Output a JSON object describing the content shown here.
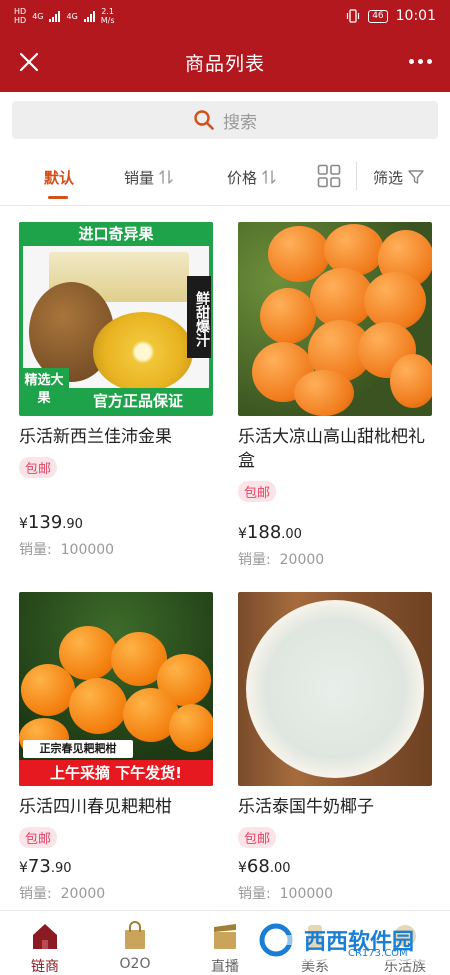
{
  "status_bar": {
    "sim1": "HD",
    "sim2": "HD",
    "net1": "4G",
    "net2": "4G",
    "speed": "2.1",
    "speed_unit": "M/s",
    "battery": "46",
    "time": "10:01"
  },
  "header": {
    "title": "商品列表",
    "close_icon": "close-icon",
    "more_icon": "more-icon"
  },
  "search": {
    "placeholder": "搜索"
  },
  "sort_bar": {
    "default_label": "默认",
    "sales_label": "销量",
    "price_label": "价格",
    "filter_label": "筛选"
  },
  "products": [
    {
      "title": "乐活新西兰佳沛金果",
      "tag": "包邮",
      "price_symbol": "¥",
      "price_int": "139",
      "price_dec": ".90",
      "sales_label": "销量:",
      "sales_value": "100000",
      "banner_top": "进口奇异果",
      "banner_side": "鲜甜爆汁",
      "banner_corner": "精选大果",
      "banner_bottom": "官方正品保证"
    },
    {
      "title": "乐活大凉山高山甜枇杷礼盒",
      "tag": "包邮",
      "price_symbol": "¥",
      "price_int": "188",
      "price_dec": ".00",
      "sales_label": "销量:",
      "sales_value": "20000"
    },
    {
      "title": "乐活四川春见耙耙柑",
      "tag": "包邮",
      "price_symbol": "¥",
      "price_int": "73",
      "price_dec": ".90",
      "sales_label": "销量:",
      "sales_value": "20000",
      "banner_label": "正宗春见耙耙柑",
      "banner_bottom": "上午采摘 下午发货!"
    },
    {
      "title": "乐活泰国牛奶椰子",
      "tag": "包邮",
      "price_symbol": "¥",
      "price_int": "68",
      "price_dec": ".00",
      "sales_label": "销量:",
      "sales_value": "100000"
    }
  ],
  "tabbar": {
    "items": [
      {
        "label": "链商",
        "active": true
      },
      {
        "label": "O2O",
        "active": false
      },
      {
        "label": "直播",
        "active": false
      },
      {
        "label": "美系",
        "active": false
      },
      {
        "label": "乐活族",
        "active": false
      }
    ]
  },
  "watermark": {
    "text": "西西软件园",
    "sub": "CR173.COM"
  },
  "colors": {
    "header_red": "#b3181f",
    "accent_orange": "#d4501a",
    "tag_pink": "#e24565",
    "tab_active": "#8b1a22"
  }
}
